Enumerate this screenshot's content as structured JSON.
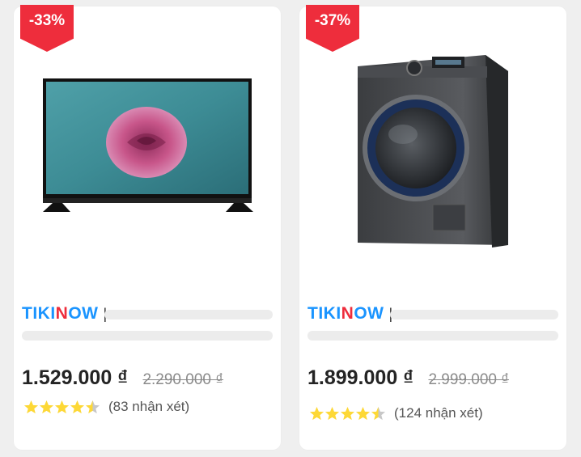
{
  "products": [
    {
      "discount": "-33%",
      "image_name": "led-tv",
      "brand": {
        "prefix": "TIKI",
        "highlight": "N",
        "suffix": "OW",
        "separator": "|"
      },
      "price": "1.529.000 ₫",
      "old_price": "2.290.000 ₫",
      "rating": 4.5,
      "reviews": "(83 nhận xét)"
    },
    {
      "discount": "-37%",
      "image_name": "front-load-washing-machine",
      "brand": {
        "prefix": "TIKI",
        "highlight": "N",
        "suffix": "OW",
        "separator": "|"
      },
      "price": "1.899.000 ₫",
      "old_price": "2.999.000 ₫",
      "rating": 4.5,
      "reviews": "(124 nhận xét)"
    }
  ],
  "colors": {
    "badge": "#ee2d3c",
    "star": "#fdd836",
    "star_empty": "#c7c7c7",
    "brand_blue": "#1a94ff",
    "brand_red": "#ee2d3c"
  }
}
